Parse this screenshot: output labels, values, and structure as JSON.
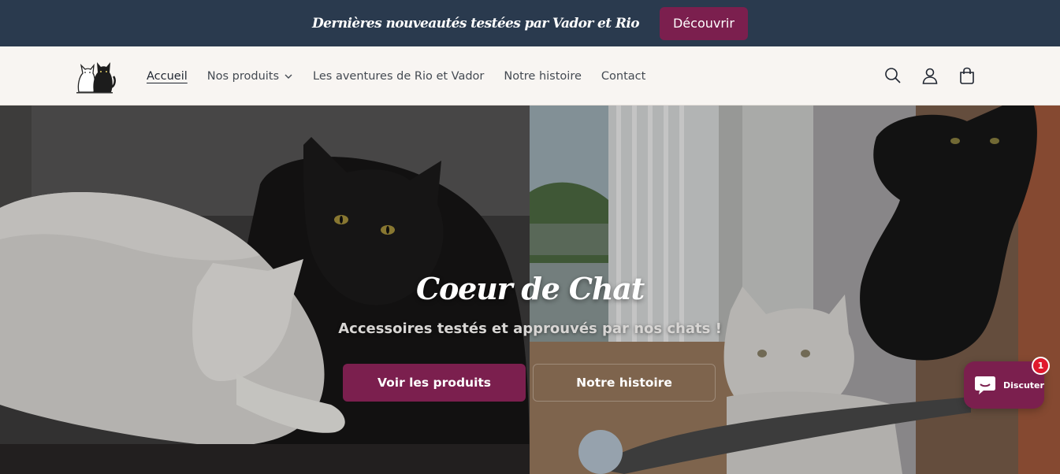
{
  "announcement": {
    "text": "Dernières nouveautés testées par Vador et Rio",
    "button_label": "Découvrir"
  },
  "header": {
    "logo_icon": "two-cats-logo-icon",
    "nav": [
      {
        "label": "Accueil",
        "active": true
      },
      {
        "label": "Nos produits",
        "has_dropdown": true
      },
      {
        "label": "Les aventures de Rio et Vador"
      },
      {
        "label": "Notre histoire"
      },
      {
        "label": "Contact"
      }
    ],
    "icons": [
      "search-icon",
      "account-icon",
      "cart-icon"
    ]
  },
  "hero": {
    "title": "Coeur de Chat",
    "subtitle": "Accessoires testés et approuvés par nos chats !",
    "primary_button": "Voir les produits",
    "secondary_button": "Notre histoire"
  },
  "chat": {
    "label": "Discuter",
    "badge": "1"
  },
  "colors": {
    "announcement_bg": "#2a3a4e",
    "accent": "#7b1f4e",
    "header_bg": "#f8f5f2",
    "badge": "#e0182d"
  }
}
